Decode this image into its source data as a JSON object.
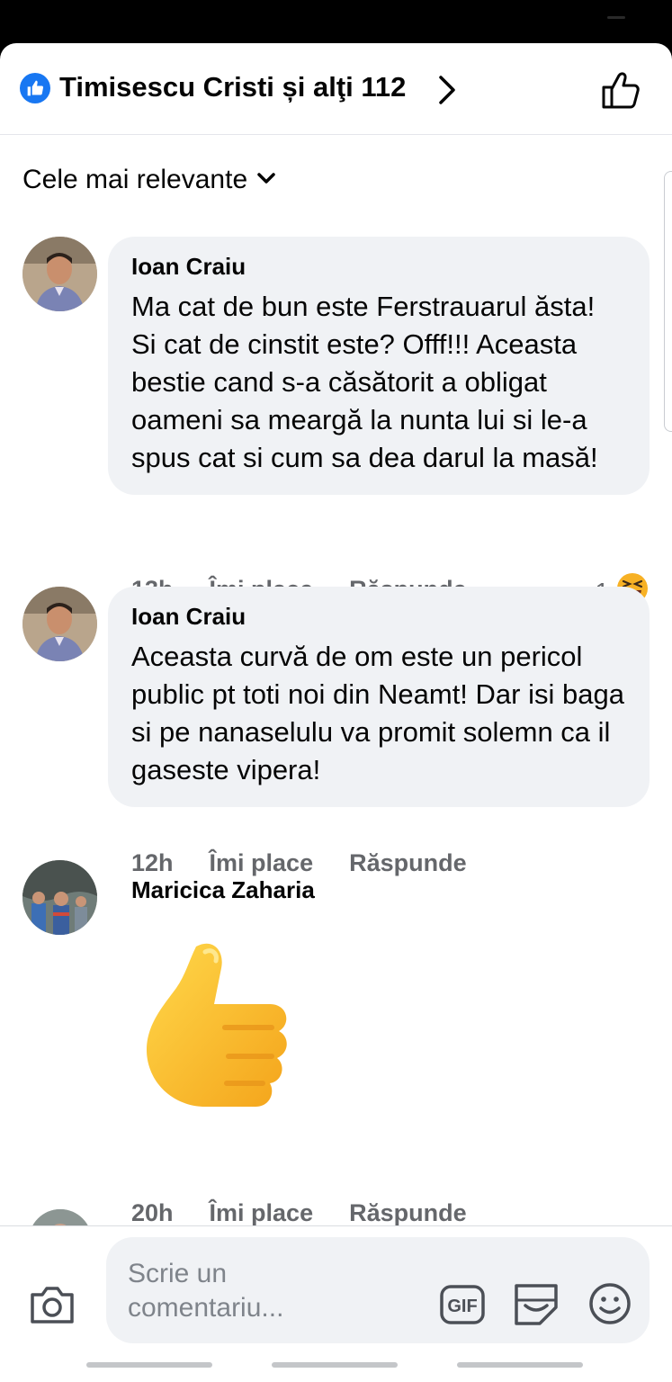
{
  "header": {
    "reactors_label": "Timisescu Cristi și alţi 112"
  },
  "sort": {
    "label": "Cele mai relevante"
  },
  "comments": [
    {
      "author": "Ioan Craiu",
      "text": "Ma cat de bun este Ferstrauarul ăsta! Si cat de cinstit este? Offf!!! Aceasta bestie cand s-a căsătorit a obligat oameni sa meargă la nunta lui si le-a spus cat si cum sa dea darul la masă!",
      "time": "13h",
      "like_label": "Îmi place",
      "reply_label": "Răspunde",
      "reaction_count": "1"
    },
    {
      "author": "Ioan Craiu",
      "text": "Aceasta curvă de om este un pericol public pt toti noi din Neamt! Dar isi baga si pe nanaselulu va promit solemn ca il gaseste vipera!",
      "time": "12h",
      "like_label": "Îmi place",
      "reply_label": "Răspunde"
    },
    {
      "author": "Maricica Zaharia",
      "sticker": "thumbs-up-emoji",
      "time": "20h",
      "like_label": "Îmi place",
      "reply_label": "Răspunde"
    }
  ],
  "composer": {
    "placeholder": "Scrie un comentariu..."
  },
  "colors": {
    "accent": "#1877f2",
    "bubble": "#f0f2f5",
    "secondary_text": "#65676b"
  }
}
